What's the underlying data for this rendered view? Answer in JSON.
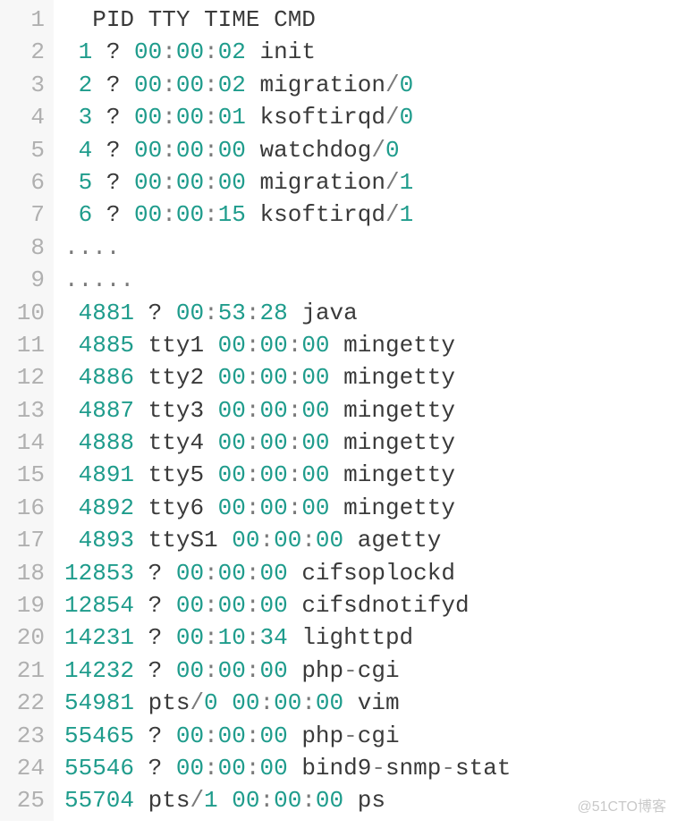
{
  "watermark": "@51CTO博客",
  "lines": [
    {
      "n": "1",
      "tokens": [
        {
          "t": "  ",
          "c": "cmd"
        },
        {
          "t": "PID",
          "c": "cmd"
        },
        {
          "t": " ",
          "c": "cmd"
        },
        {
          "t": "TTY",
          "c": "cmd"
        },
        {
          "t": " ",
          "c": "cmd"
        },
        {
          "t": "TIME",
          "c": "cmd"
        },
        {
          "t": " ",
          "c": "cmd"
        },
        {
          "t": "CMD",
          "c": "cmd"
        }
      ]
    },
    {
      "n": "2",
      "tokens": [
        {
          "t": " ",
          "c": "cmd"
        },
        {
          "t": "1",
          "c": "num"
        },
        {
          "t": " ",
          "c": "cmd"
        },
        {
          "t": "?",
          "c": "qm"
        },
        {
          "t": " ",
          "c": "cmd"
        },
        {
          "t": "00",
          "c": "time"
        },
        {
          "t": ":",
          "c": "op"
        },
        {
          "t": "00",
          "c": "time"
        },
        {
          "t": ":",
          "c": "op"
        },
        {
          "t": "02",
          "c": "time"
        },
        {
          "t": " ",
          "c": "cmd"
        },
        {
          "t": "init",
          "c": "cmd"
        }
      ]
    },
    {
      "n": "3",
      "tokens": [
        {
          "t": " ",
          "c": "cmd"
        },
        {
          "t": "2",
          "c": "num"
        },
        {
          "t": " ",
          "c": "cmd"
        },
        {
          "t": "?",
          "c": "qm"
        },
        {
          "t": " ",
          "c": "cmd"
        },
        {
          "t": "00",
          "c": "time"
        },
        {
          "t": ":",
          "c": "op"
        },
        {
          "t": "00",
          "c": "time"
        },
        {
          "t": ":",
          "c": "op"
        },
        {
          "t": "02",
          "c": "time"
        },
        {
          "t": " ",
          "c": "cmd"
        },
        {
          "t": "migration",
          "c": "cmd"
        },
        {
          "t": "/",
          "c": "op"
        },
        {
          "t": "0",
          "c": "num"
        }
      ]
    },
    {
      "n": "4",
      "tokens": [
        {
          "t": " ",
          "c": "cmd"
        },
        {
          "t": "3",
          "c": "num"
        },
        {
          "t": " ",
          "c": "cmd"
        },
        {
          "t": "?",
          "c": "qm"
        },
        {
          "t": " ",
          "c": "cmd"
        },
        {
          "t": "00",
          "c": "time"
        },
        {
          "t": ":",
          "c": "op"
        },
        {
          "t": "00",
          "c": "time"
        },
        {
          "t": ":",
          "c": "op"
        },
        {
          "t": "01",
          "c": "time"
        },
        {
          "t": " ",
          "c": "cmd"
        },
        {
          "t": "ksoftirqd",
          "c": "cmd"
        },
        {
          "t": "/",
          "c": "op"
        },
        {
          "t": "0",
          "c": "num"
        }
      ]
    },
    {
      "n": "5",
      "tokens": [
        {
          "t": " ",
          "c": "cmd"
        },
        {
          "t": "4",
          "c": "num"
        },
        {
          "t": " ",
          "c": "cmd"
        },
        {
          "t": "?",
          "c": "qm"
        },
        {
          "t": " ",
          "c": "cmd"
        },
        {
          "t": "00",
          "c": "time"
        },
        {
          "t": ":",
          "c": "op"
        },
        {
          "t": "00",
          "c": "time"
        },
        {
          "t": ":",
          "c": "op"
        },
        {
          "t": "00",
          "c": "time"
        },
        {
          "t": " ",
          "c": "cmd"
        },
        {
          "t": "watchdog",
          "c": "cmd"
        },
        {
          "t": "/",
          "c": "op"
        },
        {
          "t": "0",
          "c": "num"
        }
      ]
    },
    {
      "n": "6",
      "tokens": [
        {
          "t": " ",
          "c": "cmd"
        },
        {
          "t": "5",
          "c": "num"
        },
        {
          "t": " ",
          "c": "cmd"
        },
        {
          "t": "?",
          "c": "qm"
        },
        {
          "t": " ",
          "c": "cmd"
        },
        {
          "t": "00",
          "c": "time"
        },
        {
          "t": ":",
          "c": "op"
        },
        {
          "t": "00",
          "c": "time"
        },
        {
          "t": ":",
          "c": "op"
        },
        {
          "t": "00",
          "c": "time"
        },
        {
          "t": " ",
          "c": "cmd"
        },
        {
          "t": "migration",
          "c": "cmd"
        },
        {
          "t": "/",
          "c": "op"
        },
        {
          "t": "1",
          "c": "num"
        }
      ]
    },
    {
      "n": "7",
      "tokens": [
        {
          "t": " ",
          "c": "cmd"
        },
        {
          "t": "6",
          "c": "num"
        },
        {
          "t": " ",
          "c": "cmd"
        },
        {
          "t": "?",
          "c": "qm"
        },
        {
          "t": " ",
          "c": "cmd"
        },
        {
          "t": "00",
          "c": "time"
        },
        {
          "t": ":",
          "c": "op"
        },
        {
          "t": "00",
          "c": "time"
        },
        {
          "t": ":",
          "c": "op"
        },
        {
          "t": "15",
          "c": "time"
        },
        {
          "t": " ",
          "c": "cmd"
        },
        {
          "t": "ksoftirqd",
          "c": "cmd"
        },
        {
          "t": "/",
          "c": "op"
        },
        {
          "t": "1",
          "c": "num"
        }
      ]
    },
    {
      "n": "8",
      "tokens": [
        {
          "t": "....",
          "c": "op"
        }
      ]
    },
    {
      "n": "9",
      "tokens": [
        {
          "t": ".....",
          "c": "op"
        }
      ]
    },
    {
      "n": "10",
      "tokens": [
        {
          "t": " ",
          "c": "cmd"
        },
        {
          "t": "4881",
          "c": "num"
        },
        {
          "t": " ",
          "c": "cmd"
        },
        {
          "t": "?",
          "c": "qm"
        },
        {
          "t": " ",
          "c": "cmd"
        },
        {
          "t": "00",
          "c": "time"
        },
        {
          "t": ":",
          "c": "op"
        },
        {
          "t": "53",
          "c": "time"
        },
        {
          "t": ":",
          "c": "op"
        },
        {
          "t": "28",
          "c": "time"
        },
        {
          "t": " ",
          "c": "cmd"
        },
        {
          "t": "java",
          "c": "cmd"
        }
      ]
    },
    {
      "n": "11",
      "tokens": [
        {
          "t": " ",
          "c": "cmd"
        },
        {
          "t": "4885",
          "c": "num"
        },
        {
          "t": " ",
          "c": "cmd"
        },
        {
          "t": "tty1",
          "c": "tty"
        },
        {
          "t": " ",
          "c": "cmd"
        },
        {
          "t": "00",
          "c": "time"
        },
        {
          "t": ":",
          "c": "op"
        },
        {
          "t": "00",
          "c": "time"
        },
        {
          "t": ":",
          "c": "op"
        },
        {
          "t": "00",
          "c": "time"
        },
        {
          "t": " ",
          "c": "cmd"
        },
        {
          "t": "mingetty",
          "c": "cmd"
        }
      ]
    },
    {
      "n": "12",
      "tokens": [
        {
          "t": " ",
          "c": "cmd"
        },
        {
          "t": "4886",
          "c": "num"
        },
        {
          "t": " ",
          "c": "cmd"
        },
        {
          "t": "tty2",
          "c": "tty"
        },
        {
          "t": " ",
          "c": "cmd"
        },
        {
          "t": "00",
          "c": "time"
        },
        {
          "t": ":",
          "c": "op"
        },
        {
          "t": "00",
          "c": "time"
        },
        {
          "t": ":",
          "c": "op"
        },
        {
          "t": "00",
          "c": "time"
        },
        {
          "t": " ",
          "c": "cmd"
        },
        {
          "t": "mingetty",
          "c": "cmd"
        }
      ]
    },
    {
      "n": "13",
      "tokens": [
        {
          "t": " ",
          "c": "cmd"
        },
        {
          "t": "4887",
          "c": "num"
        },
        {
          "t": " ",
          "c": "cmd"
        },
        {
          "t": "tty3",
          "c": "tty"
        },
        {
          "t": " ",
          "c": "cmd"
        },
        {
          "t": "00",
          "c": "time"
        },
        {
          "t": ":",
          "c": "op"
        },
        {
          "t": "00",
          "c": "time"
        },
        {
          "t": ":",
          "c": "op"
        },
        {
          "t": "00",
          "c": "time"
        },
        {
          "t": " ",
          "c": "cmd"
        },
        {
          "t": "mingetty",
          "c": "cmd"
        }
      ]
    },
    {
      "n": "14",
      "tokens": [
        {
          "t": " ",
          "c": "cmd"
        },
        {
          "t": "4888",
          "c": "num"
        },
        {
          "t": " ",
          "c": "cmd"
        },
        {
          "t": "tty4",
          "c": "tty"
        },
        {
          "t": " ",
          "c": "cmd"
        },
        {
          "t": "00",
          "c": "time"
        },
        {
          "t": ":",
          "c": "op"
        },
        {
          "t": "00",
          "c": "time"
        },
        {
          "t": ":",
          "c": "op"
        },
        {
          "t": "00",
          "c": "time"
        },
        {
          "t": " ",
          "c": "cmd"
        },
        {
          "t": "mingetty",
          "c": "cmd"
        }
      ]
    },
    {
      "n": "15",
      "tokens": [
        {
          "t": " ",
          "c": "cmd"
        },
        {
          "t": "4891",
          "c": "num"
        },
        {
          "t": " ",
          "c": "cmd"
        },
        {
          "t": "tty5",
          "c": "tty"
        },
        {
          "t": " ",
          "c": "cmd"
        },
        {
          "t": "00",
          "c": "time"
        },
        {
          "t": ":",
          "c": "op"
        },
        {
          "t": "00",
          "c": "time"
        },
        {
          "t": ":",
          "c": "op"
        },
        {
          "t": "00",
          "c": "time"
        },
        {
          "t": " ",
          "c": "cmd"
        },
        {
          "t": "mingetty",
          "c": "cmd"
        }
      ]
    },
    {
      "n": "16",
      "tokens": [
        {
          "t": " ",
          "c": "cmd"
        },
        {
          "t": "4892",
          "c": "num"
        },
        {
          "t": " ",
          "c": "cmd"
        },
        {
          "t": "tty6",
          "c": "tty"
        },
        {
          "t": " ",
          "c": "cmd"
        },
        {
          "t": "00",
          "c": "time"
        },
        {
          "t": ":",
          "c": "op"
        },
        {
          "t": "00",
          "c": "time"
        },
        {
          "t": ":",
          "c": "op"
        },
        {
          "t": "00",
          "c": "time"
        },
        {
          "t": " ",
          "c": "cmd"
        },
        {
          "t": "mingetty",
          "c": "cmd"
        }
      ]
    },
    {
      "n": "17",
      "tokens": [
        {
          "t": " ",
          "c": "cmd"
        },
        {
          "t": "4893",
          "c": "num"
        },
        {
          "t": " ",
          "c": "cmd"
        },
        {
          "t": "ttyS1",
          "c": "tty"
        },
        {
          "t": " ",
          "c": "cmd"
        },
        {
          "t": "00",
          "c": "time"
        },
        {
          "t": ":",
          "c": "op"
        },
        {
          "t": "00",
          "c": "time"
        },
        {
          "t": ":",
          "c": "op"
        },
        {
          "t": "00",
          "c": "time"
        },
        {
          "t": " ",
          "c": "cmd"
        },
        {
          "t": "agetty",
          "c": "cmd"
        }
      ]
    },
    {
      "n": "18",
      "tokens": [
        {
          "t": "12853",
          "c": "num"
        },
        {
          "t": " ",
          "c": "cmd"
        },
        {
          "t": "?",
          "c": "qm"
        },
        {
          "t": " ",
          "c": "cmd"
        },
        {
          "t": "00",
          "c": "time"
        },
        {
          "t": ":",
          "c": "op"
        },
        {
          "t": "00",
          "c": "time"
        },
        {
          "t": ":",
          "c": "op"
        },
        {
          "t": "00",
          "c": "time"
        },
        {
          "t": " ",
          "c": "cmd"
        },
        {
          "t": "cifsoplockd",
          "c": "cmd"
        }
      ]
    },
    {
      "n": "19",
      "tokens": [
        {
          "t": "12854",
          "c": "num"
        },
        {
          "t": " ",
          "c": "cmd"
        },
        {
          "t": "?",
          "c": "qm"
        },
        {
          "t": " ",
          "c": "cmd"
        },
        {
          "t": "00",
          "c": "time"
        },
        {
          "t": ":",
          "c": "op"
        },
        {
          "t": "00",
          "c": "time"
        },
        {
          "t": ":",
          "c": "op"
        },
        {
          "t": "00",
          "c": "time"
        },
        {
          "t": " ",
          "c": "cmd"
        },
        {
          "t": "cifsdnotifyd",
          "c": "cmd"
        }
      ]
    },
    {
      "n": "20",
      "tokens": [
        {
          "t": "14231",
          "c": "num"
        },
        {
          "t": " ",
          "c": "cmd"
        },
        {
          "t": "?",
          "c": "qm"
        },
        {
          "t": " ",
          "c": "cmd"
        },
        {
          "t": "00",
          "c": "time"
        },
        {
          "t": ":",
          "c": "op"
        },
        {
          "t": "10",
          "c": "time"
        },
        {
          "t": ":",
          "c": "op"
        },
        {
          "t": "34",
          "c": "time"
        },
        {
          "t": " ",
          "c": "cmd"
        },
        {
          "t": "lighttpd",
          "c": "cmd"
        }
      ]
    },
    {
      "n": "21",
      "tokens": [
        {
          "t": "14232",
          "c": "num"
        },
        {
          "t": " ",
          "c": "cmd"
        },
        {
          "t": "?",
          "c": "qm"
        },
        {
          "t": " ",
          "c": "cmd"
        },
        {
          "t": "00",
          "c": "time"
        },
        {
          "t": ":",
          "c": "op"
        },
        {
          "t": "00",
          "c": "time"
        },
        {
          "t": ":",
          "c": "op"
        },
        {
          "t": "00",
          "c": "time"
        },
        {
          "t": " ",
          "c": "cmd"
        },
        {
          "t": "php",
          "c": "cmd"
        },
        {
          "t": "-",
          "c": "op"
        },
        {
          "t": "cgi",
          "c": "cmd"
        }
      ]
    },
    {
      "n": "22",
      "tokens": [
        {
          "t": "54981",
          "c": "num"
        },
        {
          "t": " ",
          "c": "cmd"
        },
        {
          "t": "pts",
          "c": "cmd"
        },
        {
          "t": "/",
          "c": "op"
        },
        {
          "t": "0",
          "c": "num"
        },
        {
          "t": " ",
          "c": "cmd"
        },
        {
          "t": "00",
          "c": "time"
        },
        {
          "t": ":",
          "c": "op"
        },
        {
          "t": "00",
          "c": "time"
        },
        {
          "t": ":",
          "c": "op"
        },
        {
          "t": "00",
          "c": "time"
        },
        {
          "t": " ",
          "c": "cmd"
        },
        {
          "t": "vim",
          "c": "cmd"
        }
      ]
    },
    {
      "n": "23",
      "tokens": [
        {
          "t": "55465",
          "c": "num"
        },
        {
          "t": " ",
          "c": "cmd"
        },
        {
          "t": "?",
          "c": "qm"
        },
        {
          "t": " ",
          "c": "cmd"
        },
        {
          "t": "00",
          "c": "time"
        },
        {
          "t": ":",
          "c": "op"
        },
        {
          "t": "00",
          "c": "time"
        },
        {
          "t": ":",
          "c": "op"
        },
        {
          "t": "00",
          "c": "time"
        },
        {
          "t": " ",
          "c": "cmd"
        },
        {
          "t": "php",
          "c": "cmd"
        },
        {
          "t": "-",
          "c": "op"
        },
        {
          "t": "cgi",
          "c": "cmd"
        }
      ]
    },
    {
      "n": "24",
      "tokens": [
        {
          "t": "55546",
          "c": "num"
        },
        {
          "t": " ",
          "c": "cmd"
        },
        {
          "t": "?",
          "c": "qm"
        },
        {
          "t": " ",
          "c": "cmd"
        },
        {
          "t": "00",
          "c": "time"
        },
        {
          "t": ":",
          "c": "op"
        },
        {
          "t": "00",
          "c": "time"
        },
        {
          "t": ":",
          "c": "op"
        },
        {
          "t": "00",
          "c": "time"
        },
        {
          "t": " ",
          "c": "cmd"
        },
        {
          "t": "bind9",
          "c": "cmd"
        },
        {
          "t": "-",
          "c": "op"
        },
        {
          "t": "snmp",
          "c": "cmd"
        },
        {
          "t": "-",
          "c": "op"
        },
        {
          "t": "stat",
          "c": "cmd"
        }
      ]
    },
    {
      "n": "25",
      "tokens": [
        {
          "t": "55704",
          "c": "num"
        },
        {
          "t": " ",
          "c": "cmd"
        },
        {
          "t": "pts",
          "c": "cmd"
        },
        {
          "t": "/",
          "c": "op"
        },
        {
          "t": "1",
          "c": "num"
        },
        {
          "t": " ",
          "c": "cmd"
        },
        {
          "t": "00",
          "c": "time"
        },
        {
          "t": ":",
          "c": "op"
        },
        {
          "t": "00",
          "c": "time"
        },
        {
          "t": ":",
          "c": "op"
        },
        {
          "t": "00",
          "c": "time"
        },
        {
          "t": " ",
          "c": "cmd"
        },
        {
          "t": "ps",
          "c": "cmd"
        }
      ]
    }
  ]
}
